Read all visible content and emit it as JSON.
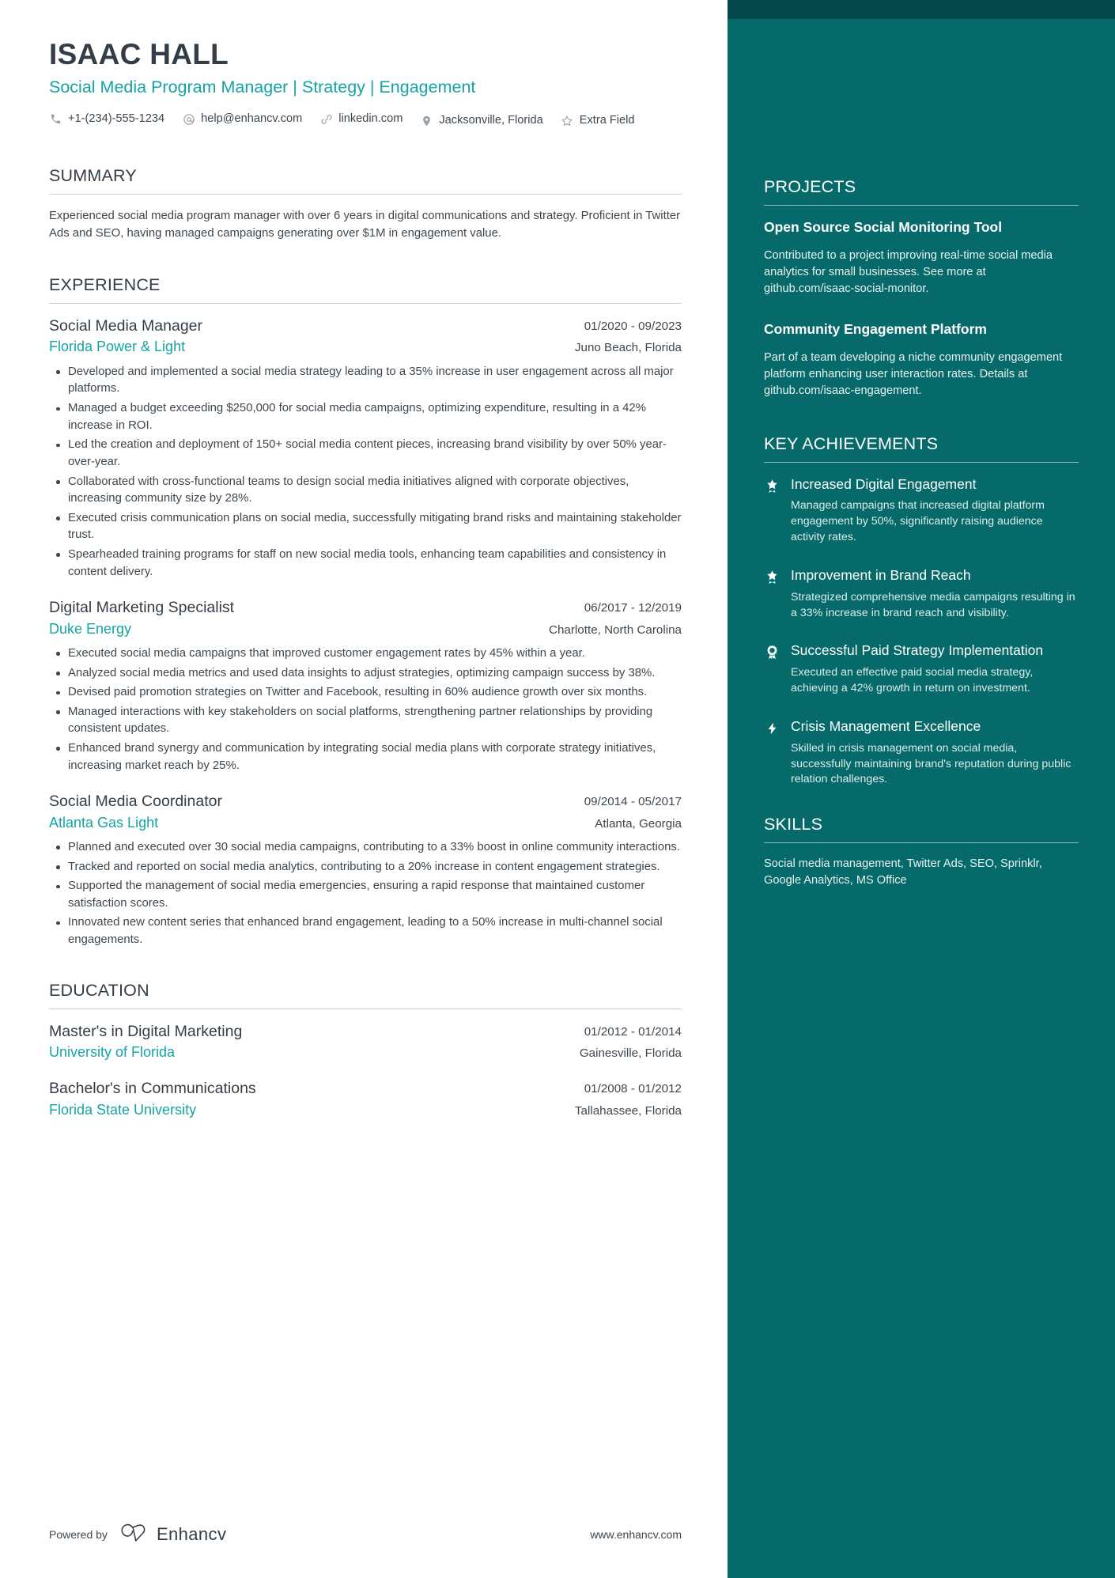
{
  "colors": {
    "accent_teal": "#16a3a3",
    "sidebar_bg": "#076a6a",
    "sidebar_topband": "#03484a",
    "heading_dark": "#333d47"
  },
  "header": {
    "name": "ISAAC HALL",
    "headline": "Social Media Program Manager | Strategy | Engagement",
    "contacts": [
      {
        "icon": "phone-icon",
        "text": "+1-(234)-555-1234"
      },
      {
        "icon": "email-icon",
        "text": "help@enhancv.com"
      },
      {
        "icon": "link-icon",
        "text": "linkedin.com"
      },
      {
        "icon": "location-icon",
        "text": "Jacksonville, Florida"
      },
      {
        "icon": "star-outline-icon",
        "text": "Extra Field"
      }
    ]
  },
  "summary": {
    "title": "SUMMARY",
    "body": "Experienced social media program manager with over 6 years in digital communications and strategy. Proficient in Twitter Ads and SEO, having managed campaigns generating over $1M in engagement value."
  },
  "experience": {
    "title": "EXPERIENCE",
    "entries": [
      {
        "role": "Social Media Manager",
        "dates": "01/2020 - 09/2023",
        "company": "Florida Power & Light",
        "location": "Juno Beach, Florida",
        "bullets": [
          "Developed and implemented a social media strategy leading to a 35% increase in user engagement across all major platforms.",
          "Managed a budget exceeding $250,000 for social media campaigns, optimizing expenditure, resulting in a 42% increase in ROI.",
          "Led the creation and deployment of 150+ social media content pieces, increasing brand visibility by over 50% year-over-year.",
          "Collaborated with cross-functional teams to design social media initiatives aligned with corporate objectives, increasing community size by 28%.",
          "Executed crisis communication plans on social media, successfully mitigating brand risks and maintaining stakeholder trust.",
          "Spearheaded training programs for staff on new social media tools, enhancing team capabilities and consistency in content delivery."
        ]
      },
      {
        "role": "Digital Marketing Specialist",
        "dates": "06/2017 - 12/2019",
        "company": "Duke Energy",
        "location": "Charlotte, North Carolina",
        "bullets": [
          "Executed social media campaigns that improved customer engagement rates by 45% within a year.",
          "Analyzed social media metrics and used data insights to adjust strategies, optimizing campaign success by 38%.",
          "Devised paid promotion strategies on Twitter and Facebook, resulting in 60% audience growth over six months.",
          "Managed interactions with key stakeholders on social platforms, strengthening partner relationships by providing consistent updates.",
          "Enhanced brand synergy and communication by integrating social media plans with corporate strategy initiatives, increasing market reach by 25%."
        ]
      },
      {
        "role": "Social Media Coordinator",
        "dates": "09/2014 - 05/2017",
        "company": "Atlanta Gas Light",
        "location": "Atlanta, Georgia",
        "bullets": [
          "Planned and executed over 30 social media campaigns, contributing to a 33% boost in online community interactions.",
          "Tracked and reported on social media analytics, contributing to a 20% increase in content engagement strategies.",
          "Supported the management of social media emergencies, ensuring a rapid response that maintained customer satisfaction scores.",
          "Innovated new content series that enhanced brand engagement, leading to a 50% increase in multi-channel social engagements."
        ]
      }
    ]
  },
  "education": {
    "title": "EDUCATION",
    "entries": [
      {
        "degree": "Master's in Digital Marketing",
        "dates": "01/2012 - 01/2014",
        "school": "University of Florida",
        "location": "Gainesville, Florida"
      },
      {
        "degree": "Bachelor's in Communications",
        "dates": "01/2008 - 01/2012",
        "school": "Florida State University",
        "location": "Tallahassee, Florida"
      }
    ]
  },
  "footer": {
    "powered_by": "Powered by",
    "brand": "Enhancv",
    "site": "www.enhancv.com"
  },
  "sidebar": {
    "projects": {
      "title": "PROJECTS",
      "items": [
        {
          "name": "Open Source Social Monitoring Tool",
          "description": "Contributed to a project improving real-time social media analytics for small businesses. See more at github.com/isaac-social-monitor."
        },
        {
          "name": "Community Engagement Platform",
          "description": "Part of a team developing a niche community engagement platform enhancing user interaction rates. Details at github.com/isaac-engagement."
        }
      ]
    },
    "achievements": {
      "title": "KEY ACHIEVEMENTS",
      "items": [
        {
          "icon": "star-badge-icon",
          "name": "Increased Digital Engagement",
          "description": "Managed campaigns that increased digital platform engagement by 50%, significantly raising audience activity rates."
        },
        {
          "icon": "star-badge-icon",
          "name": "Improvement in Brand Reach",
          "description": "Strategized comprehensive media campaigns resulting in a 33% increase in brand reach and visibility."
        },
        {
          "icon": "award-medal-icon",
          "name": "Successful Paid Strategy Implementation",
          "description": "Executed an effective paid social media strategy, achieving a 42% growth in return on investment."
        },
        {
          "icon": "lightning-bolt-icon",
          "name": "Crisis Management Excellence",
          "description": "Skilled in crisis management on social media, successfully maintaining brand's reputation during public relation challenges."
        }
      ]
    },
    "skills": {
      "title": "SKILLS",
      "body": "Social media management, Twitter Ads, SEO, Sprinklr, Google Analytics, MS Office"
    }
  }
}
